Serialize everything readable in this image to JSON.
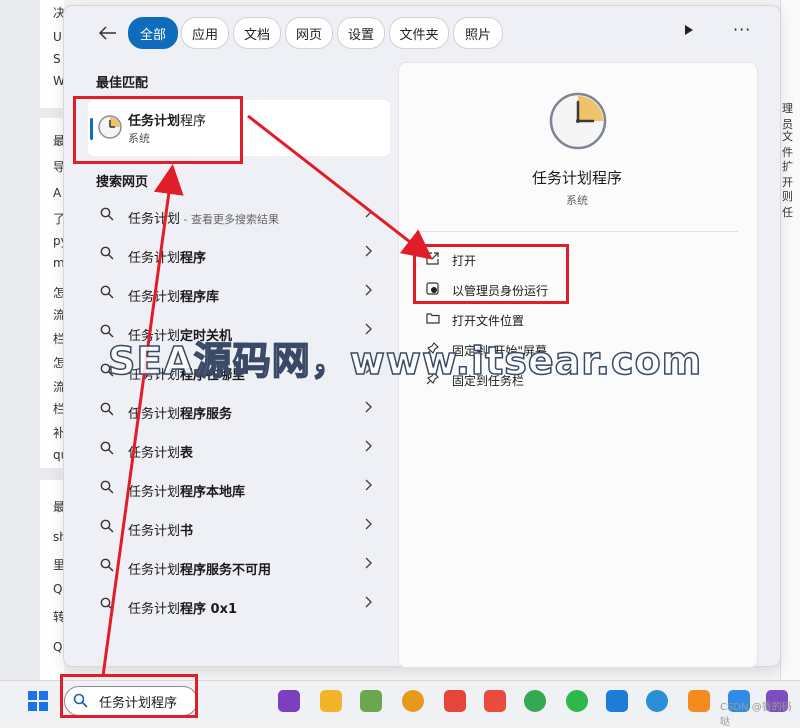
{
  "tabs": [
    "全部",
    "应用",
    "文档",
    "网页",
    "设置",
    "文件夹",
    "照片"
  ],
  "best_match": {
    "heading": "最佳匹配",
    "title": "任务计划程序",
    "subtitle": "系统"
  },
  "web_search": {
    "heading": "搜索网页",
    "items": [
      {
        "prefix": "任务计划",
        "bold": "",
        "hint": " - 查看更多搜索结果"
      },
      {
        "prefix": "任务计划",
        "bold": "程序",
        "hint": ""
      },
      {
        "prefix": "任务计划",
        "bold": "程序库",
        "hint": ""
      },
      {
        "prefix": "任务计划",
        "bold": "定时关机",
        "hint": ""
      },
      {
        "prefix": "任务计划",
        "bold": "程序在哪里",
        "hint": ""
      },
      {
        "prefix": "任务计划",
        "bold": "程序服务",
        "hint": ""
      },
      {
        "prefix": "任务计划",
        "bold": "表",
        "hint": ""
      },
      {
        "prefix": "任务计划",
        "bold": "程序本地库",
        "hint": ""
      },
      {
        "prefix": "任务计划",
        "bold": "书",
        "hint": ""
      },
      {
        "prefix": "任务计划",
        "bold": "程序服务不可用",
        "hint": ""
      },
      {
        "prefix": "任务计划",
        "bold": "程序 0x1",
        "hint": ""
      }
    ]
  },
  "detail": {
    "title": "任务计划程序",
    "subtitle": "系统",
    "actions": [
      "打开",
      "以管理员身份运行",
      "打开文件位置",
      "固定到\"开始\"屏幕",
      "固定到任务栏"
    ]
  },
  "watermark": "SEA源码网，www.itsear.com",
  "search_box": {
    "value": "任务计划程序"
  },
  "csdn_mark": "CSDN @香的码哒",
  "background_left": [
    "决",
    "U",
    "S",
    "W",
    "最",
    "导",
    "A",
    "了",
    "py",
    "m",
    "怎",
    "流",
    "栏",
    "怎",
    "流",
    "栏",
    "补",
    "qu",
    "最",
    "sh",
    "里",
    "Q",
    "转",
    "Q"
  ],
  "background_right": [
    "理员",
    "文件",
    "扩开",
    "则任"
  ],
  "colors": {
    "accent": "#0f6cbd",
    "annotation_red": "#e11d2a"
  }
}
